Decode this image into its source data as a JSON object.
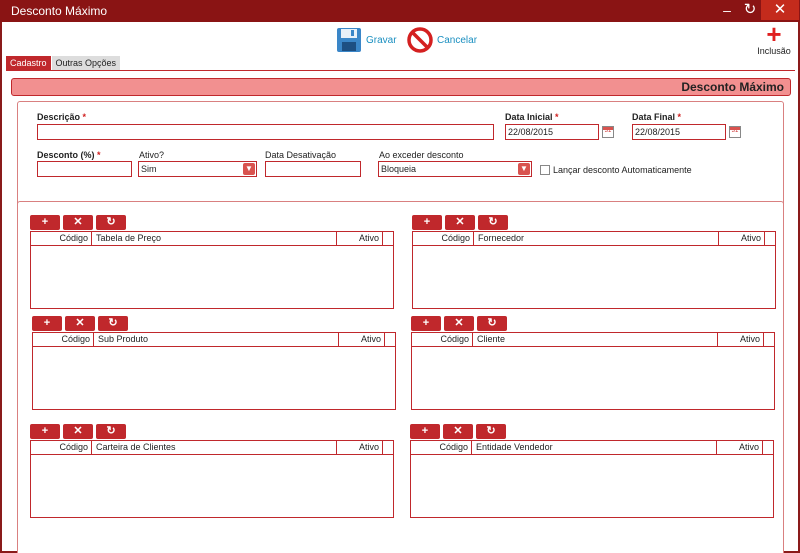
{
  "window": {
    "title": "Desconto Máximo"
  },
  "toolbar": {
    "save_label": "Gravar",
    "cancel_label": "Cancelar",
    "inclusao_label": "Inclusão"
  },
  "tabs": [
    {
      "label": "Cadastro",
      "active": true
    },
    {
      "label": "Outras Opções",
      "active": false
    }
  ],
  "header": {
    "title": "Desconto Máximo"
  },
  "form": {
    "descricao": {
      "label": "Descrição",
      "required": "*",
      "value": ""
    },
    "data_inicial": {
      "label": "Data Inicial",
      "required": "*",
      "value": "22/08/2015"
    },
    "data_final": {
      "label": "Data Final",
      "required": "*",
      "value": "22/08/2015"
    },
    "desconto": {
      "label": "Desconto (%)",
      "required": "*",
      "value": ""
    },
    "ativo": {
      "label": "Ativo?",
      "value": "Sim"
    },
    "data_desativacao": {
      "label": "Data Desativação",
      "value": ""
    },
    "ao_exceder": {
      "label": "Ao exceder desconto",
      "value": "Bloqueia"
    },
    "lancar_auto": {
      "label": "Lançar desconto Automaticamente",
      "checked": false
    }
  },
  "grid_buttons": {
    "add": "+",
    "remove": "✕",
    "refresh": "↻"
  },
  "grids": {
    "tabela_preco": {
      "col_code": "Código",
      "col_desc": "Tabela de Preço",
      "col_ativo": "Ativo"
    },
    "fornecedor": {
      "col_code": "Código",
      "col_desc": "Fornecedor",
      "col_ativo": "Ativo"
    },
    "sub_produto": {
      "col_code": "Código",
      "col_desc": "Sub Produto",
      "col_ativo": "Ativo"
    },
    "cliente": {
      "col_code": "Código",
      "col_desc": "Cliente",
      "col_ativo": "Ativo"
    },
    "carteira": {
      "col_code": "Código",
      "col_desc": "Carteira de Clientes",
      "col_ativo": "Ativo"
    },
    "vendedor": {
      "col_code": "Código",
      "col_desc": "Entidade Vendedor",
      "col_ativo": "Ativo"
    }
  },
  "colors": {
    "accent": "#c0282c",
    "titlebar": "#8a1414",
    "header_fill": "#f29090",
    "link": "#1a8fc0"
  }
}
